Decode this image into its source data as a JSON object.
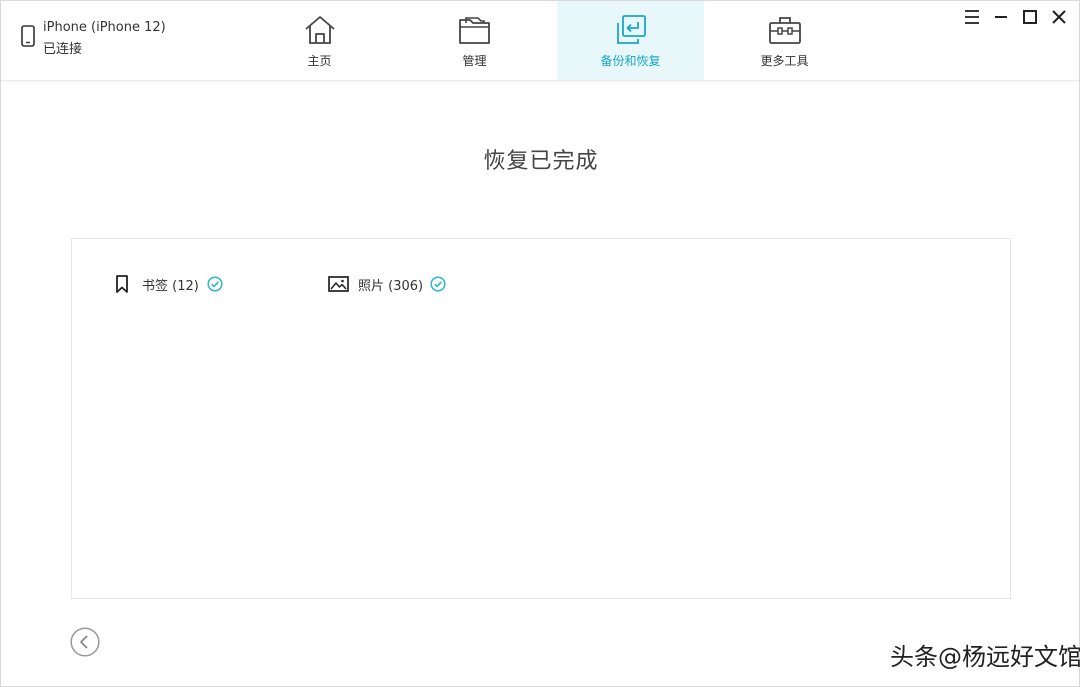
{
  "device": {
    "name": "iPhone (iPhone 12)",
    "status": "已连接"
  },
  "nav": {
    "tabs": [
      {
        "label": "主页",
        "icon": "home-icon"
      },
      {
        "label": "管理",
        "icon": "folder-icon"
      },
      {
        "label": "备份和恢复",
        "icon": "backup-restore-icon",
        "active": true
      },
      {
        "label": "更多工具",
        "icon": "toolbox-icon"
      }
    ]
  },
  "window_controls": [
    "menu-icon",
    "minimize-icon",
    "maximize-icon",
    "close-icon"
  ],
  "main": {
    "title": "恢复已完成",
    "items": [
      {
        "label": "书签 (12)",
        "icon": "bookmark-icon",
        "status": "completed"
      },
      {
        "label": "照片 (306)",
        "icon": "photo-icon",
        "status": "completed"
      }
    ]
  },
  "back_button": "back-arrow-icon",
  "watermark": "头条@杨远好文馆",
  "colors": {
    "accent": "#1aa7c6",
    "active_tab_bg": "#e8f7fa",
    "check": "#2bb7c9"
  }
}
